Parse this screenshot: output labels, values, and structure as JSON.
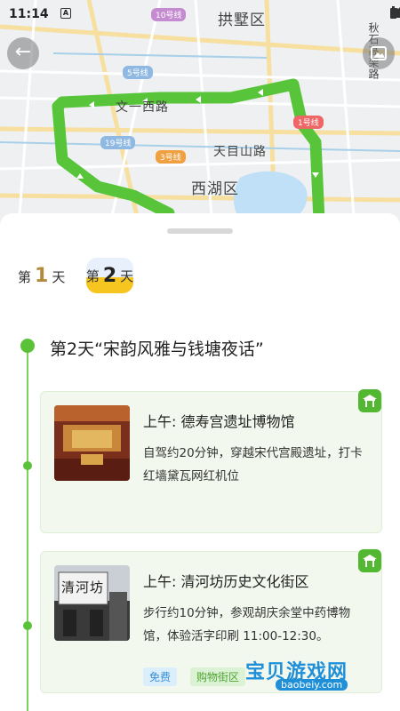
{
  "status_bar": {
    "time": "11:14",
    "notification_glyph": "A"
  },
  "map": {
    "labels": {
      "gongshu": "拱墅区",
      "xihu": "西湖区",
      "wenyi": "文一西路",
      "tianmu": "天目山路",
      "qiushi": "秋石高架路"
    },
    "line_badges": {
      "line10": "10号线",
      "line5": "5号线",
      "line19": "19号线",
      "line3": "3号线",
      "line1": "1号线"
    },
    "route_color": "#57c43a"
  },
  "tabs": [
    {
      "pre": "第",
      "num": "1",
      "post": "天"
    },
    {
      "pre": "第",
      "num": "2",
      "post": "天"
    }
  ],
  "day_title": "第2天“宋韵风雅与钱塘夜话”",
  "cards": [
    {
      "title": "上午: 德寿宫遗址博物馆",
      "desc": "自驾约20分钟，穿越宋代宫殿遗址，打卡红墙黛瓦网红机位",
      "tag_icon": "pavilion-icon"
    },
    {
      "title": "上午: 清河坊历史文化街区",
      "desc": "步行约10分钟，参观胡庆余堂中药博物馆，体验活字印刷 11:00-12:30。",
      "chips": [
        "免费",
        "购物街区"
      ],
      "tag_icon": "pavilion-icon",
      "thumb_text": "清河坊"
    }
  ],
  "watermark": {
    "text": "宝贝游戏网",
    "url": "baobeiy.com"
  },
  "colors": {
    "accent_green": "#52b832",
    "tab_yellow": "#f6c520"
  }
}
